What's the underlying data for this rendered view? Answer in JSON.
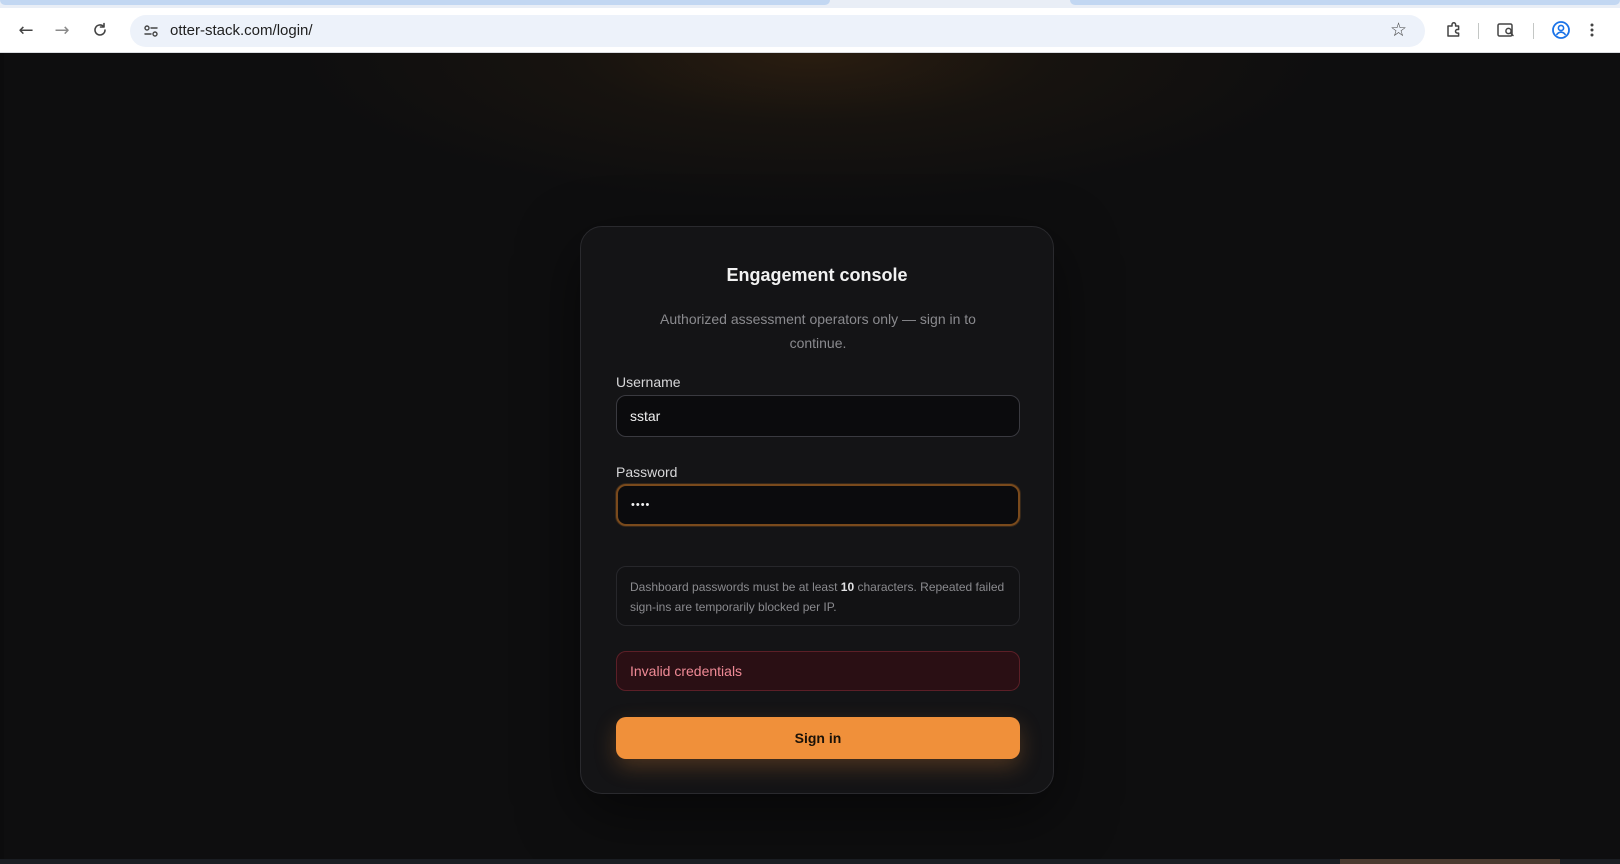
{
  "browser": {
    "url": "otter-stack.com/login/",
    "back_glyph": "←",
    "forward_glyph": "→",
    "reload_glyph": "C",
    "bookmark_glyph": "☆",
    "icons": [
      "back-arrow-icon",
      "forward-arrow-icon",
      "reload-icon",
      "site-info-icon",
      "bookmark-star-icon",
      "extensions-icon",
      "reading-list-icon",
      "profile-icon",
      "more-menu-icon"
    ]
  },
  "login": {
    "title": "Engagement console",
    "subtitle": "Authorized assessment operators only — sign in to continue.",
    "username_label": "Username",
    "username_value": "sstar",
    "password_label": "Password",
    "password_masked": "••••",
    "hint_prefix": "Dashboard passwords must be at least ",
    "hint_min_length": "10",
    "hint_suffix": " characters. Repeated failed sign-ins are temporarily blocked per IP.",
    "error": "Invalid credentials",
    "submit": "Sign in"
  },
  "colors": {
    "accent": "#f0903a",
    "error_text": "#f08a96",
    "error_bg": "#2a0f14",
    "card_bg": "#141416",
    "page_bg": "#0c0c0d"
  }
}
